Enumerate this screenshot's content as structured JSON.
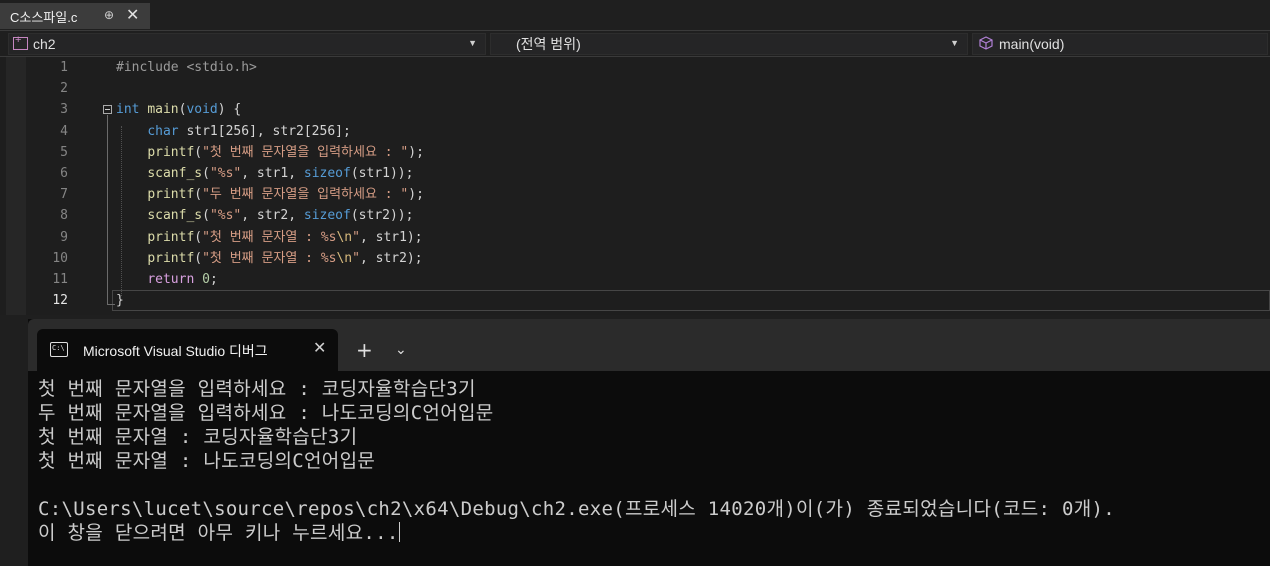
{
  "file_tab": {
    "name": "C소스파일.c",
    "pin": "⊕",
    "close": "✕"
  },
  "navbar": {
    "project": "ch2",
    "scope": "(전역 범위)",
    "function": "main(void)"
  },
  "editor": {
    "line_numbers": [
      "1",
      "2",
      "3",
      "4",
      "5",
      "6",
      "7",
      "8",
      "9",
      "10",
      "11",
      "12"
    ],
    "lines": [
      [
        {
          "t": "#include <stdio.h>",
          "c": "inc"
        }
      ],
      [],
      [
        {
          "t": "int",
          "c": "kw"
        },
        {
          "t": " ",
          "c": "txt"
        },
        {
          "t": "main",
          "c": "fn"
        },
        {
          "t": "(",
          "c": "txt"
        },
        {
          "t": "void",
          "c": "kw"
        },
        {
          "t": ") {",
          "c": "txt"
        }
      ],
      [
        {
          "t": "    ",
          "c": "txt"
        },
        {
          "t": "char",
          "c": "kw"
        },
        {
          "t": " str1[256], str2[256];",
          "c": "txt"
        }
      ],
      [
        {
          "t": "    ",
          "c": "txt"
        },
        {
          "t": "printf",
          "c": "fn"
        },
        {
          "t": "(",
          "c": "txt"
        },
        {
          "t": "\"첫 번째 문자열을 입력하세요 : \"",
          "c": "str"
        },
        {
          "t": ");",
          "c": "txt"
        }
      ],
      [
        {
          "t": "    ",
          "c": "txt"
        },
        {
          "t": "scanf_s",
          "c": "fn"
        },
        {
          "t": "(",
          "c": "txt"
        },
        {
          "t": "\"%s\"",
          "c": "str"
        },
        {
          "t": ", str1, ",
          "c": "txt"
        },
        {
          "t": "sizeof",
          "c": "kw"
        },
        {
          "t": "(str1));",
          "c": "txt"
        }
      ],
      [
        {
          "t": "    ",
          "c": "txt"
        },
        {
          "t": "printf",
          "c": "fn"
        },
        {
          "t": "(",
          "c": "txt"
        },
        {
          "t": "\"두 번째 문자열을 입력하세요 : \"",
          "c": "str"
        },
        {
          "t": ");",
          "c": "txt"
        }
      ],
      [
        {
          "t": "    ",
          "c": "txt"
        },
        {
          "t": "scanf_s",
          "c": "fn"
        },
        {
          "t": "(",
          "c": "txt"
        },
        {
          "t": "\"%s\"",
          "c": "str"
        },
        {
          "t": ", str2, ",
          "c": "txt"
        },
        {
          "t": "sizeof",
          "c": "kw"
        },
        {
          "t": "(str2));",
          "c": "txt"
        }
      ],
      [
        {
          "t": "    ",
          "c": "txt"
        },
        {
          "t": "printf",
          "c": "fn"
        },
        {
          "t": "(",
          "c": "txt"
        },
        {
          "t": "\"첫 번째 문자열 : %s",
          "c": "str"
        },
        {
          "t": "\\n",
          "c": "esc"
        },
        {
          "t": "\"",
          "c": "str"
        },
        {
          "t": ", str1);",
          "c": "txt"
        }
      ],
      [
        {
          "t": "    ",
          "c": "txt"
        },
        {
          "t": "printf",
          "c": "fn"
        },
        {
          "t": "(",
          "c": "txt"
        },
        {
          "t": "\"첫 번째 문자열 : %s",
          "c": "str"
        },
        {
          "t": "\\n",
          "c": "esc"
        },
        {
          "t": "\"",
          "c": "str"
        },
        {
          "t": ", str2);",
          "c": "txt"
        }
      ],
      [
        {
          "t": "    ",
          "c": "txt"
        },
        {
          "t": "return",
          "c": "ret"
        },
        {
          "t": " ",
          "c": "txt"
        },
        {
          "t": "0",
          "c": "num"
        },
        {
          "t": ";",
          "c": "txt"
        }
      ],
      [
        {
          "t": "}",
          "c": "txt"
        }
      ]
    ]
  },
  "terminal": {
    "tab_title": "Microsoft Visual Studio 디버그",
    "icon_text": "C:\\",
    "close": "✕",
    "new_tab": "+",
    "dropdown": "⌄",
    "output": [
      "첫 번째 문자열을 입력하세요 : 코딩자율학습단3기",
      "두 번째 문자열을 입력하세요 : 나도코딩의C언어입문",
      "첫 번째 문자열 : 코딩자율학습단3기",
      "첫 번째 문자열 : 나도코딩의C언어입문",
      "",
      "C:\\Users\\lucet\\source\\repos\\ch2\\x64\\Debug\\ch2.exe(프로세스 14020개)이(가) 종료되었습니다(코드: 0개).",
      "이 창을 닫으려면 아무 키나 누르세요..."
    ]
  }
}
